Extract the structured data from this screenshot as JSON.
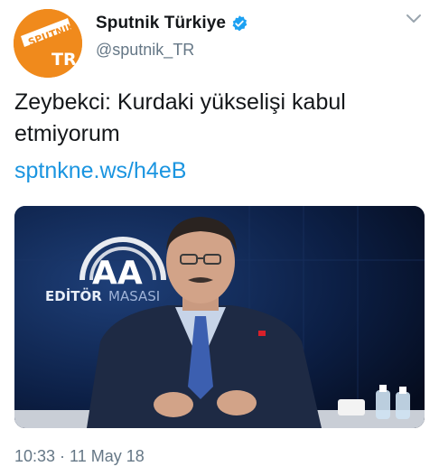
{
  "tweet": {
    "display_name": "Sputnik Türkiye",
    "handle": "@sputnik_TR",
    "avatar_text_top": "SPUTNIK",
    "avatar_text_bottom": "TR",
    "text_line1": "Zeybekci: Kurdaki yükselişi kabul",
    "text_line2": "etmiyorum",
    "link": "sptnkne.ws/h4eB",
    "timestamp": "10:33 · 11 May 18"
  },
  "media": {
    "logo_text": "AA",
    "backdrop_text_bold": "EDİTÖR",
    "backdrop_text_light": "MASASI"
  },
  "colors": {
    "accent": "#1b95e0",
    "secondary_text": "#657786",
    "avatar_orange": "#f08a1c",
    "verified_blue": "#1da1f2"
  },
  "icons": [
    "verified-badge-icon",
    "chevron-down-icon"
  ]
}
